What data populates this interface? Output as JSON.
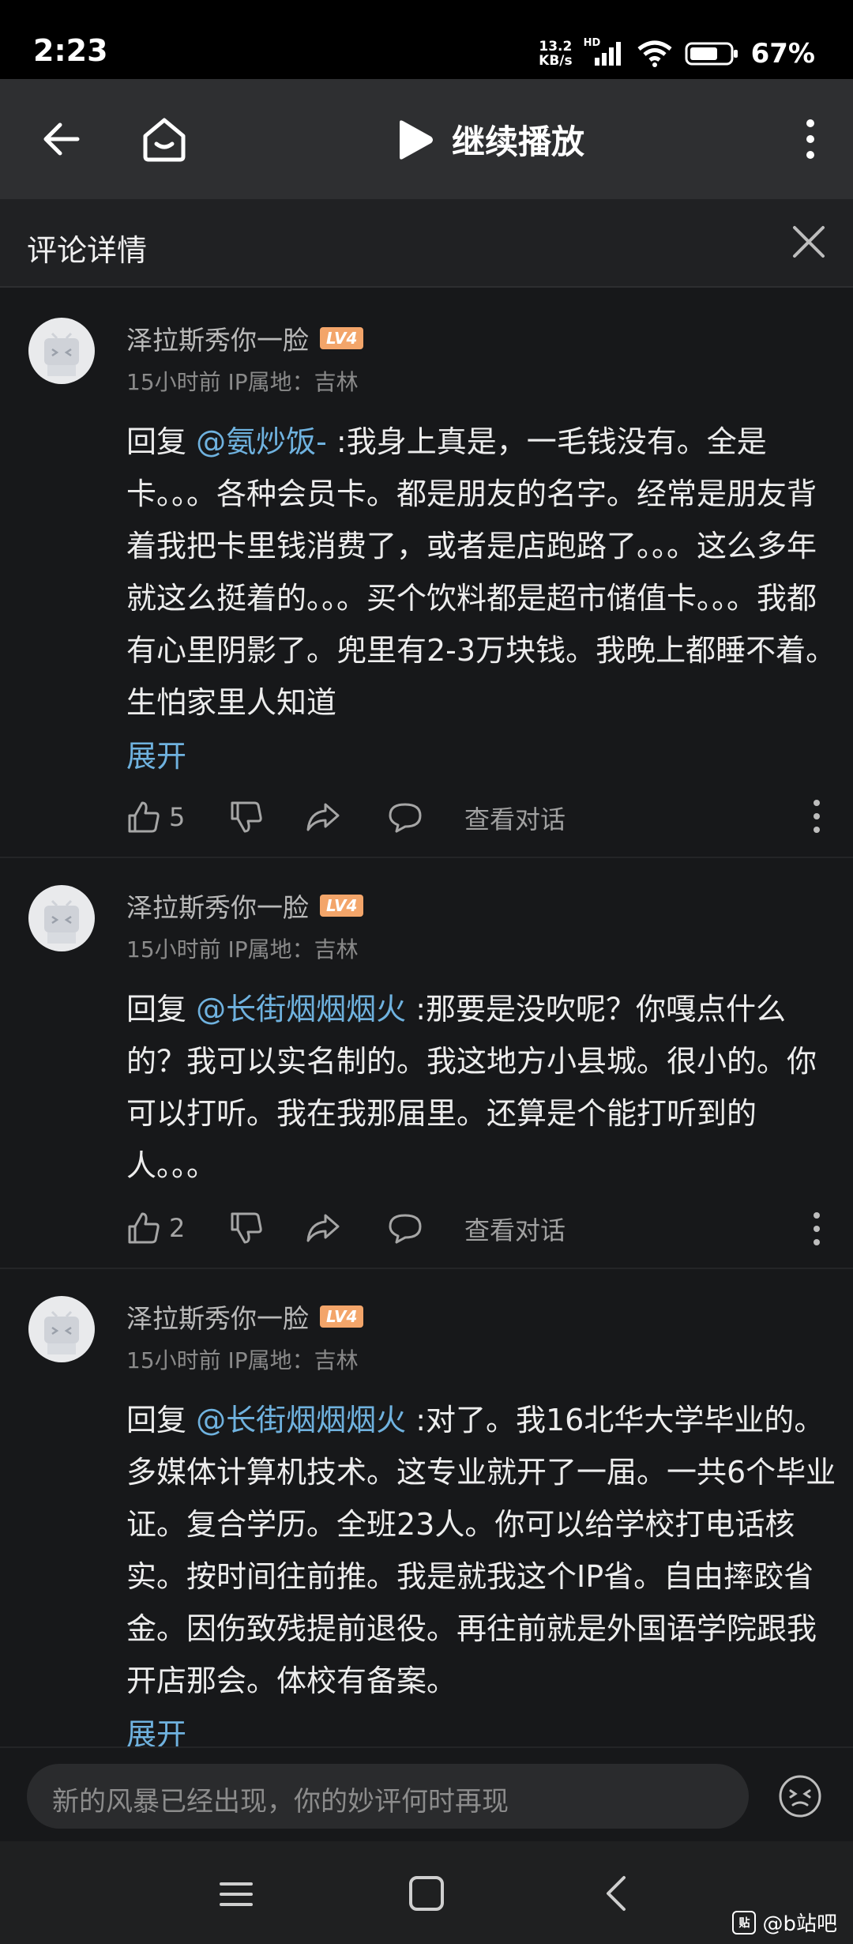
{
  "status_bar": {
    "time": "2:23",
    "speed_value": "13.2",
    "speed_unit": "KB/s",
    "network": "HD",
    "battery_percent": "67%"
  },
  "nav": {
    "play_label": "继续播放",
    "icons": [
      "back-arrow-icon",
      "home-icon",
      "play-icon",
      "more-vertical-icon"
    ]
  },
  "comments_header": {
    "title": "评论详情"
  },
  "comments": [
    {
      "username": "泽拉斯秀你一脸",
      "level": "LV4",
      "meta": "15小时前 IP属地：吉林",
      "reply_prefix": "回复 ",
      "mention": "@氨炒饭-",
      "text": " :我身上真是，一毛钱没有。全是卡。。。各种会员卡。都是朋友的名字。经常是朋友背着我把卡里钱消费了，或者是店跑路了。。。这么多年就这么挺着的。。。买个饮料都是超市储值卡。。。我都有心里阴影了。兜里有2-3万块钱。我晚上都睡不着。生怕家里人知道",
      "expand": "展开",
      "likes": "5",
      "dialog": "查看对话"
    },
    {
      "username": "泽拉斯秀你一脸",
      "level": "LV4",
      "meta": "15小时前 IP属地：吉林",
      "reply_prefix": "回复 ",
      "mention": "@长街烟烟烟火",
      "text": " :那要是没吹呢？你嘎点什么的？我可以实名制的。我这地方小县城。很小的。你可以打听。我在我那届里。还算是个能打听到的人。。。",
      "expand": "",
      "likes": "2",
      "dialog": "查看对话"
    },
    {
      "username": "泽拉斯秀你一脸",
      "level": "LV4",
      "meta": "15小时前 IP属地：吉林",
      "reply_prefix": "回复 ",
      "mention": "@长街烟烟烟火",
      "text": " :对了。我16北华大学毕业的。多媒体计算机技术。这专业就开了一届。一共6个毕业证。复合学历。全班23人。你可以给学校打电话核实。按时间往前推。我是就我这个IP省。自由摔跤省金。因伤致残提前退役。再往前就是外国语学院跟我开店那会。体校有备案。",
      "expand": "展开",
      "likes": "",
      "dialog": ""
    }
  ],
  "input": {
    "placeholder": "新的风暴已经出现，你的妙评何时再现"
  },
  "watermark": {
    "logo_text": "贴",
    "text": "@b站吧"
  },
  "colors": {
    "accent_link": "#6fb2df",
    "level_badge": "#f3a56a",
    "background": "#17181a"
  }
}
